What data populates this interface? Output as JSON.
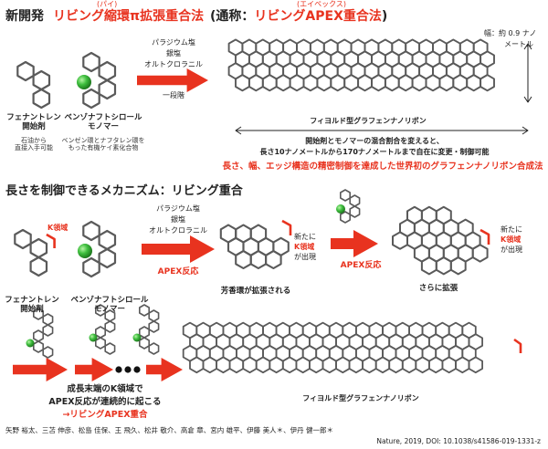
{
  "header": {
    "prefix": "新開発",
    "main_title": "リビング縮環π拡張重合法",
    "ruby_pai": "(パイ)",
    "paren_title_open": "(通称：",
    "paren_title_red": "リビングAPEX重合法",
    "paren_title_close": ")",
    "ruby_apex": "(エイペックス)"
  },
  "section1": {
    "phenanthrene_name_line1": "フェナントレン",
    "phenanthrene_name_line2": "開始剤",
    "phenanthrene_note_line1": "石油から",
    "phenanthrene_note_line2": "直接入手可能",
    "monomer_name_line1": "ベンゾナフトシロール",
    "monomer_name_line2": "モノマー",
    "monomer_note_line1": "ベンゼン環とナフタレン環を",
    "monomer_note_line2": "もった有機ケイ素化合物",
    "reagent_1": "パラジウム塩",
    "reagent_2": "銀塩",
    "reagent_3": "オルトクロラニル",
    "one_step": "一段階",
    "width_label_1": "幅：約 0.9 ナノ",
    "width_label_2": "メートル",
    "ribbon_label": "フィヨルド型グラフェンナノリボン",
    "desc_line1": "開始剤とモノマーの混合割合を変えると、",
    "desc_line2": "長さ10ナノメートルから170ナノメートルまで自在に変更・制御可能",
    "highlight": "長さ、幅、エッジ構造の精密制御を達成した世界初のグラフェンナノリボン合成法"
  },
  "section2": {
    "title": "長さを制御できるメカニズム：リビング重合",
    "k_region": "K領域",
    "phenanthrene_name_line1": "フェナントレン",
    "phenanthrene_name_line2": "開始剤",
    "monomer_name_line1": "ベンゾナフトシロール",
    "monomer_name_line2": "モノマー",
    "reagent_1": "パラジウム塩",
    "reagent_2": "銀塩",
    "reagent_3": "オルトクロラニル",
    "apex_reaction": "APEX反応",
    "aromatic_expand": "芳香環が拡張される",
    "new_label": "新たに",
    "appear_label": "が出現",
    "apex_reaction_2": "APEX反応",
    "further_expand": "さらに拡張",
    "new_label_2": "新たに",
    "k_region_2": "K領域",
    "appear_label_2": "が出現",
    "chain_line1": "成長末端のK領域で",
    "chain_line2": "APEX反応が連続的に起こる",
    "chain_line3": "→リビングAPEX重合",
    "ribbon_label_2": "フィヨルド型グラフェンナノリボン"
  },
  "footer": {
    "authors": "矢野 裕太、三苫 伸彦、松島 佳保、王 飛久、松井 敬介、高倉 章、宮内 雄平、伊藤 美人＊、伊丹 健一郎＊",
    "citation": "Nature, 2019, DOI: 10.1038/s41586-019-1331-z"
  },
  "colors": {
    "accent_red": "#e8331f",
    "hexagon_gray": "#5a5a5a",
    "silicon_green": "#3fbf3f"
  }
}
